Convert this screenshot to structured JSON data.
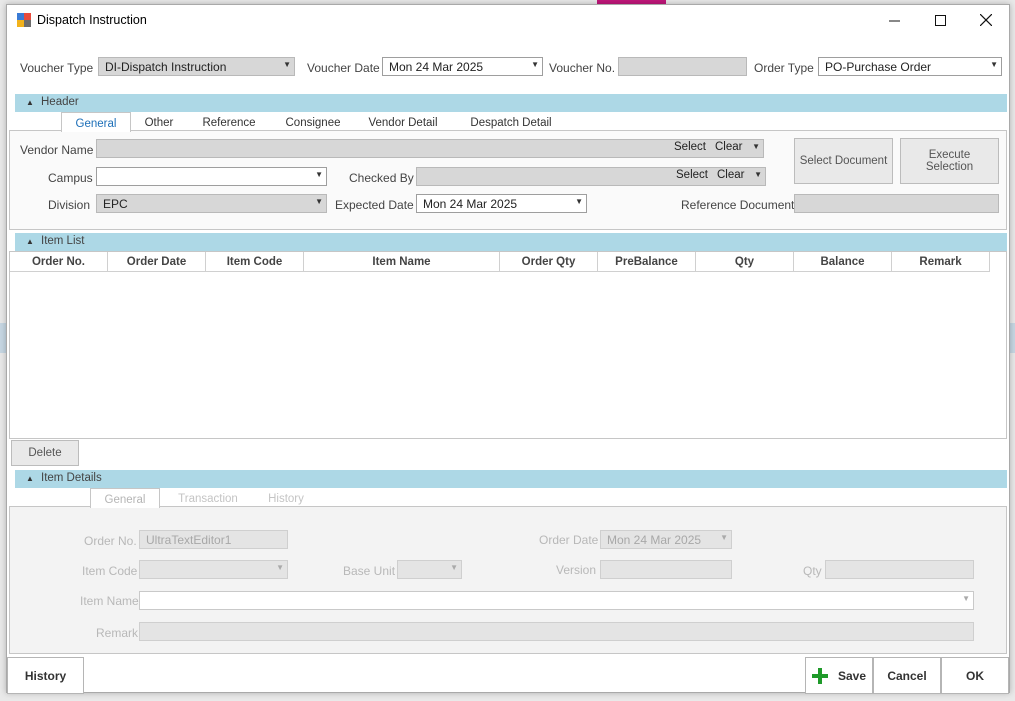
{
  "window": {
    "title": "Dispatch Instruction"
  },
  "top_fields": {
    "voucher_type_label": "Voucher Type",
    "voucher_type_value": "DI-Dispatch Instruction",
    "voucher_date_label": "Voucher Date",
    "voucher_date_value": "Mon 24 Mar 2025",
    "voucher_no_label": "Voucher No.",
    "voucher_no_value": "",
    "order_type_label": "Order Type",
    "order_type_value": "PO-Purchase Order"
  },
  "header_section": {
    "title": "Header",
    "tabs": [
      "General",
      "Other",
      "Reference",
      "Consignee",
      "Vendor Detail",
      "Despatch Detail"
    ],
    "vendor_name_label": "Vendor Name",
    "campus_label": "Campus",
    "division_label": "Division",
    "division_value": "EPC",
    "checked_by_label": "Checked By",
    "expected_date_label": "Expected Date",
    "expected_date_value": "Mon 24 Mar 2025",
    "reference_document_label": "Reference Document",
    "select_label": "Select",
    "clear_label": "Clear",
    "select_document_button": "Select Document",
    "execute_selection_button": "Execute Selection"
  },
  "item_list_section": {
    "title": "Item List",
    "columns": [
      "Order No.",
      "Order Date",
      "Item Code",
      "Item Name",
      "Order Qty",
      "PreBalance",
      "Qty",
      "Balance",
      "Remark"
    ],
    "rows": [],
    "delete_button": "Delete"
  },
  "item_details_section": {
    "title": "Item Details",
    "tabs": [
      "General",
      "Transaction",
      "History"
    ],
    "order_no_label": "Order No.",
    "order_no_value": "UltraTextEditor1",
    "order_date_label": "Order Date",
    "order_date_value": "Mon 24 Mar 2025",
    "item_code_label": "Item Code",
    "base_unit_label": "Base Unit",
    "version_label": "Version",
    "qty_label": "Qty",
    "item_name_label": "Item Name",
    "remark_label": "Remark"
  },
  "footer": {
    "history_button": "History",
    "save_button": "Save",
    "cancel_button": "Cancel",
    "ok_button": "OK"
  },
  "colors": {
    "section_header": "#add8e6",
    "active_tab_text": "#1d6fb8",
    "save_icon": "#1f9a2a"
  }
}
